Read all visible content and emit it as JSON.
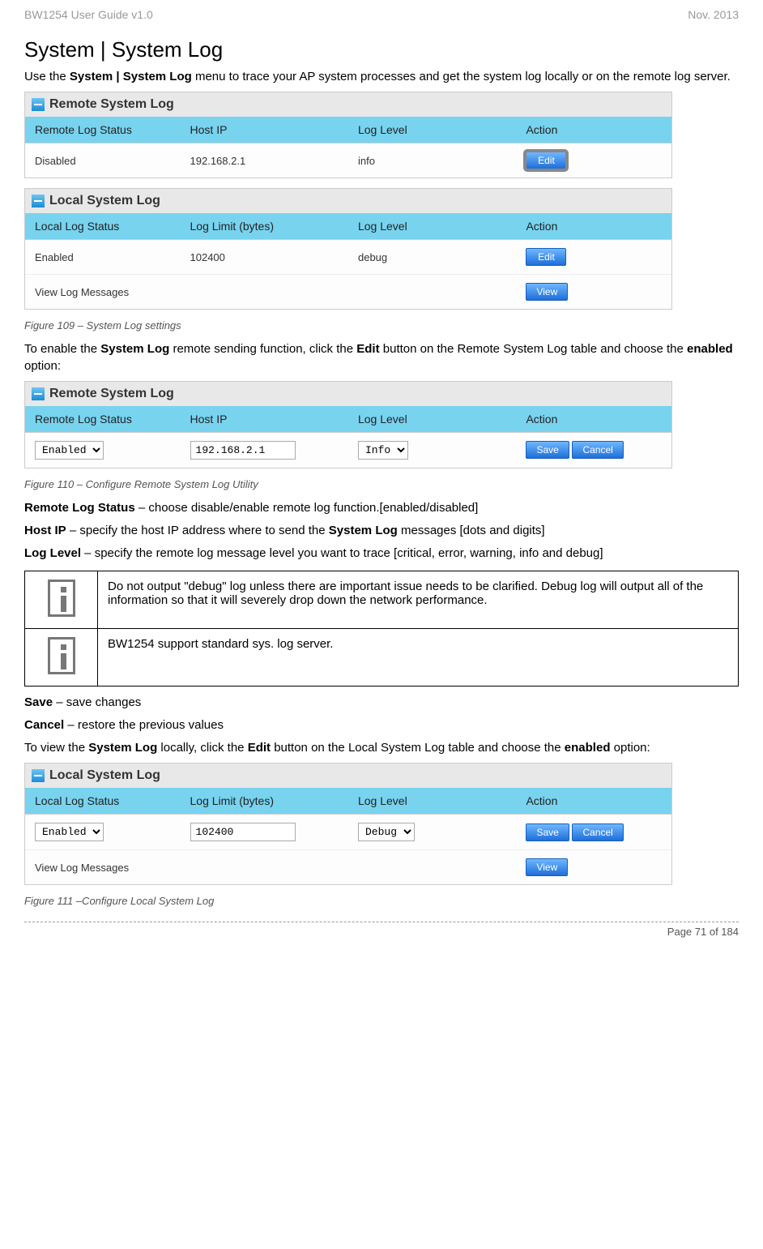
{
  "header": {
    "left": "BW1254 User Guide v1.0",
    "right": "Nov.  2013"
  },
  "title": "System | System Log",
  "intro_pre": "Use the ",
  "intro_bold": "System | System Log",
  "intro_post": " menu to trace your AP system processes and get the system log locally or on the remote log server.",
  "remote_panel": {
    "title": "Remote System Log",
    "headers": [
      "Remote Log Status",
      "Host IP",
      "Log Level",
      "Action"
    ],
    "row": {
      "status": "Disabled",
      "host": "192.168.2.1",
      "level": "info"
    },
    "edit_label": "Edit"
  },
  "local_panel": {
    "title": "Local System Log",
    "headers": [
      "Local Log Status",
      "Log Limit (bytes)",
      "Log Level",
      "Action"
    ],
    "row": {
      "status": "Enabled",
      "limit": "102400",
      "level": "debug"
    },
    "view_row_label": "View Log Messages",
    "edit_label": "Edit",
    "view_label": "View"
  },
  "fig109": "Figure 109 – System Log settings",
  "para2_pre": "To enable the ",
  "para2_b1": "System Log",
  "para2_mid": " remote sending function, click the ",
  "para2_b2": "Edit",
  "para2_mid2": " button on the Remote System Log table and choose the ",
  "para2_b3": "enabled",
  "para2_post": " option:",
  "remote_edit_panel": {
    "title": "Remote System Log",
    "headers": [
      "Remote Log Status",
      "Host IP",
      "Log Level",
      "Action"
    ],
    "status_value": "Enabled",
    "host_value": "192.168.2.1",
    "level_value": "Info",
    "save_label": "Save",
    "cancel_label": "Cancel"
  },
  "fig110": "Figure 110 – Configure Remote System Log Utility",
  "desc_remote_status_b": "Remote Log Status",
  "desc_remote_status": " – choose disable/enable remote log function.[enabled/disabled]",
  "desc_hostip_b": "Host IP",
  "desc_hostip": " – specify the host IP address where to send the ",
  "desc_hostip_b2": "System Log",
  "desc_hostip_post": " messages [dots and digits]",
  "desc_loglevel_b": "Log Level",
  "desc_loglevel": " – specify the remote log message level you want to trace [critical, error, warning, info and debug]",
  "info1": "Do not output \"debug\" log unless there are important issue needs to be clarified. Debug log will output all of the information so that it will severely drop down the network performance.",
  "info2": "BW1254 support standard sys. log server.",
  "save_b": "Save",
  "save_txt": " – save changes",
  "cancel_b": "Cancel",
  "cancel_txt": " – restore the previous values",
  "para3_pre": "To view the ",
  "para3_b1": "System Log",
  "para3_mid": " locally, click the ",
  "para3_b2": "Edit",
  "para3_mid2": " button on the Local System Log table and choose the ",
  "para3_b3": "enabled",
  "para3_post": " option:",
  "local_edit_panel": {
    "title": "Local System Log",
    "headers": [
      "Local Log Status",
      "Log Limit (bytes)",
      "Log Level",
      "Action"
    ],
    "status_value": "Enabled",
    "limit_value": "102400",
    "level_value": "Debug",
    "view_row_label": "View Log Messages",
    "save_label": "Save",
    "cancel_label": "Cancel",
    "view_label": "View"
  },
  "fig111": "Figure 111 –Configure Local System Log",
  "footer": "Page 71 of 184"
}
